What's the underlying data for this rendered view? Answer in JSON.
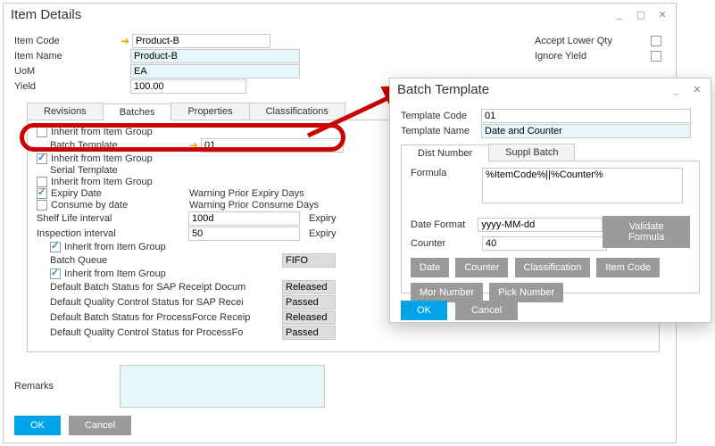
{
  "item_details": {
    "title": "Item Details",
    "item_code_label": "Item Code",
    "item_code_value": "Product-B",
    "item_name_label": "Item Name",
    "item_name_value": "Product-B",
    "uom_label": "UoM",
    "uom_value": "EA",
    "yield_label": "Yield",
    "yield_value": "100.00",
    "accept_lower_qty_label": "Accept Lower Qty",
    "ignore_yield_label": "Ignore Yield",
    "tabs": {
      "revisions": "Revisions",
      "batches": "Batches",
      "properties": "Properties",
      "classifications": "Classifications"
    },
    "batches_panel": {
      "inherit1": "Inherit from Item Group",
      "batch_template_label": "Batch Template",
      "batch_template_value": "01",
      "inherit2": "Inherit from Item Group",
      "serial_template_label": "Serial Template",
      "inherit3": "Inherit from Item Group",
      "expiry_date_label": "Expiry Date",
      "warning_prior_expiry_label": "Warning Prior Expiry Days",
      "consume_by_date_label": "Consume by date",
      "warning_prior_consume_label": "Warning Prior Consume Days",
      "shelf_life_label": "Shelf Life interval",
      "shelf_life_value": "100d",
      "shelf_life_expiry": "Expiry",
      "inspection_label": "Inspection interval",
      "inspection_value": "50",
      "inspection_expiry": "Expiry",
      "inherit4": "Inherit from Item Group",
      "batch_queue_label": "Batch Queue",
      "batch_queue_value": "FIFO",
      "inherit5": "Inherit from Item Group",
      "default_batch_status_label": "Default Batch Status for SAP Receipt Docum",
      "default_batch_status_value": "Released",
      "default_qc_status_label": "Default Quality Control Status for SAP Recei",
      "default_qc_status_value": "Passed",
      "default_batch_pf_label": "Default Batch Status for ProcessForce Receip",
      "default_batch_pf_value": "Released",
      "default_qc_pf_label": "Default Quality Control Status for ProcessFo",
      "default_qc_pf_value": "Passed"
    },
    "remarks_label": "Remarks",
    "ok": "OK",
    "cancel": "Cancel"
  },
  "batch_template": {
    "title": "Batch Template",
    "template_code_label": "Template Code",
    "template_code_value": "01",
    "template_name_label": "Template Name",
    "template_name_value": "Date and Counter",
    "tabs": {
      "dist_number": "Dist Number",
      "suppl_batch": "Suppl Batch"
    },
    "formula_label": "Formula",
    "formula_value": "%ItemCode%||%Counter%",
    "date_format_label": "Date Format",
    "date_format_value": "yyyy-MM-dd",
    "counter_label": "Counter",
    "counter_value": "40",
    "validate": "Validate Formula",
    "chips": {
      "date": "Date",
      "counter": "Counter",
      "classification": "Classification",
      "item_code": "Item Code",
      "mor_number": "Mor Number",
      "pick_number": "Pick Number"
    },
    "ok": "OK",
    "cancel": "Cancel"
  }
}
